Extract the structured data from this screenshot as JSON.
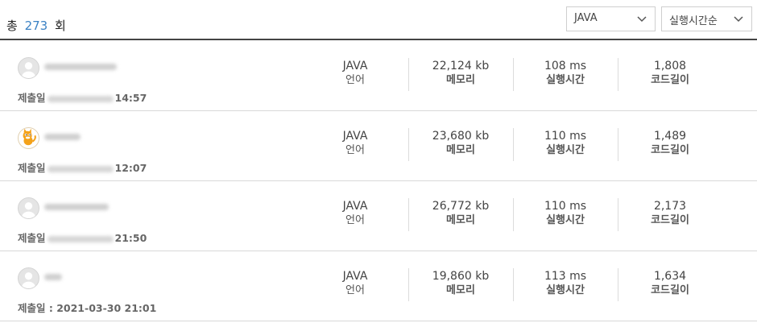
{
  "summary": {
    "prefix": "총",
    "count": "273",
    "suffix": "회"
  },
  "filters": {
    "language": {
      "selected": "JAVA"
    },
    "sort": {
      "selected": "실행시간순"
    }
  },
  "labels": {
    "submitted": "제출일",
    "language": "언어",
    "memory": "메모리",
    "runtime": "실행시간",
    "code_length": "코드길이"
  },
  "rows": [
    {
      "submit_time": "14:57",
      "submit_full": "",
      "language": "JAVA",
      "memory": "22,124 kb",
      "runtime": "108 ms",
      "code_length": "1,808"
    },
    {
      "submit_time": "12:07",
      "submit_full": "",
      "language": "JAVA",
      "memory": "23,680 kb",
      "runtime": "110 ms",
      "code_length": "1,489"
    },
    {
      "submit_time": "21:50",
      "submit_full": "",
      "language": "JAVA",
      "memory": "26,772 kb",
      "runtime": "110 ms",
      "code_length": "2,173"
    },
    {
      "submit_time": "",
      "submit_full": "2021-03-30 21:01",
      "language": "JAVA",
      "memory": "19,860 kb",
      "runtime": "113 ms",
      "code_length": "1,634"
    }
  ]
}
